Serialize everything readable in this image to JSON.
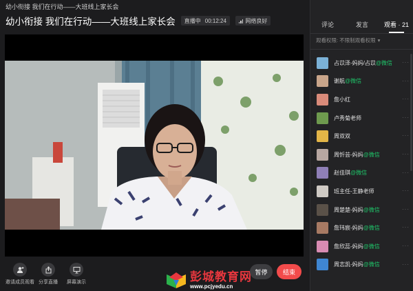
{
  "window": {
    "title": "幼小衔接  我们在行动——大班线上家长会"
  },
  "header": {
    "title": "幼小衔接  我们在行动——大班线上家长会",
    "live_status": "直播中",
    "elapsed": "00:12:24",
    "network": "网络良好"
  },
  "toolbar": {
    "invite_label": "邀请成员观看",
    "share_label": "分享直播",
    "screen_label": "屏幕演示",
    "pause_label": "暂停",
    "end_label": "结束"
  },
  "watermark": {
    "name": "彭城教育网",
    "url": "www.pcjyedu.cn"
  },
  "panel": {
    "tabs": [
      {
        "label": "评论"
      },
      {
        "label": "发言"
      },
      {
        "label": "观看 · 21"
      }
    ],
    "permission": "观看权限: 不限制观看权限",
    "wechat_tag": "@微信",
    "viewers": [
      {
        "name": "占苡泽-妈妈/占苡",
        "tag": "@微信",
        "color": "#7bb1d6"
      },
      {
        "name": "谢航",
        "tag": "@微信",
        "color": "#c9a58a"
      },
      {
        "name": "詹小红",
        "tag": "",
        "color": "#d98b7a"
      },
      {
        "name": "卢秀菊老师",
        "tag": "",
        "color": "#6e9a4e"
      },
      {
        "name": "周双双",
        "tag": "",
        "color": "#e3b547"
      },
      {
        "name": "周忻芸-妈妈",
        "tag": "@微信",
        "color": "#b8a7a1"
      },
      {
        "name": "赵佳琪",
        "tag": "@微信",
        "color": "#8f7fb6"
      },
      {
        "name": "班主任-王静老师",
        "tag": "",
        "color": "#cfcac4"
      },
      {
        "name": "周楚楚-妈妈",
        "tag": "@微信",
        "color": "#5a5148"
      },
      {
        "name": "詹玮宸-妈妈",
        "tag": "@微信",
        "color": "#a77a63"
      },
      {
        "name": "詹欣蕊-妈妈",
        "tag": "@微信",
        "color": "#d88bb2"
      },
      {
        "name": "周志凯-妈妈",
        "tag": "@微信",
        "color": "#3f86d2"
      }
    ]
  },
  "colors": {
    "accent_red": "#f24b4b",
    "wechat_green": "#1fc66a"
  }
}
